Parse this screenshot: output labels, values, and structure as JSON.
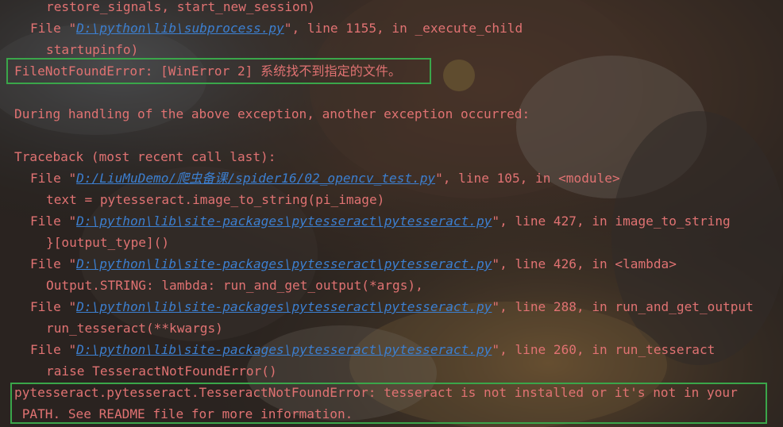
{
  "colors": {
    "error_text": "#e07272",
    "link": "#3c7fd0",
    "highlight_border": "#3aa64a",
    "background": "#2b2b2b"
  },
  "lines": [
    {
      "text": "restore_signals, start_new_session)"
    },
    {
      "prefix": "File \"",
      "link": "D:\\python\\lib\\subprocess.py",
      "suffix": "\", line 1155, in _execute_child"
    },
    {
      "text": "startupinfo)"
    },
    {
      "text": "FileNotFoundError: [WinError 2] 系统找不到指定的文件。"
    },
    {
      "text": ""
    },
    {
      "text": "During handling of the above exception, another exception occurred:"
    },
    {
      "text": ""
    },
    {
      "text": "Traceback (most recent call last):"
    },
    {
      "prefix": "File \"",
      "link": "D:/LiuMuDemo/爬虫备课/spider16/02_opencv_test.py",
      "suffix": "\", line 105, in <module>"
    },
    {
      "text": "text = pytesseract.image_to_string(pi_image)"
    },
    {
      "prefix": "File \"",
      "link": "D:\\python\\lib\\site-packages\\pytesseract\\pytesseract.py",
      "suffix": "\", line 427, in image_to_string"
    },
    {
      "text": "}[output_type]()"
    },
    {
      "prefix": "File \"",
      "link": "D:\\python\\lib\\site-packages\\pytesseract\\pytesseract.py",
      "suffix": "\", line 426, in <lambda>"
    },
    {
      "text": "Output.STRING: lambda: run_and_get_output(*args),"
    },
    {
      "prefix": "File \"",
      "link": "D:\\python\\lib\\site-packages\\pytesseract\\pytesseract.py",
      "suffix": "\", line 288, in run_and_get_output"
    },
    {
      "text": "run_tesseract(**kwargs)"
    },
    {
      "prefix": "File \"",
      "link": "D:\\python\\lib\\site-packages\\pytesseract\\pytesseract.py",
      "suffix": "\", line 260, in run_tesseract"
    },
    {
      "text": "raise TesseractNotFoundError()"
    },
    {
      "text": "pytesseract.pytesseract.TesseractNotFoundError: tesseract is not installed or it's not in your"
    },
    {
      "text": " PATH. See README file for more information."
    }
  ]
}
